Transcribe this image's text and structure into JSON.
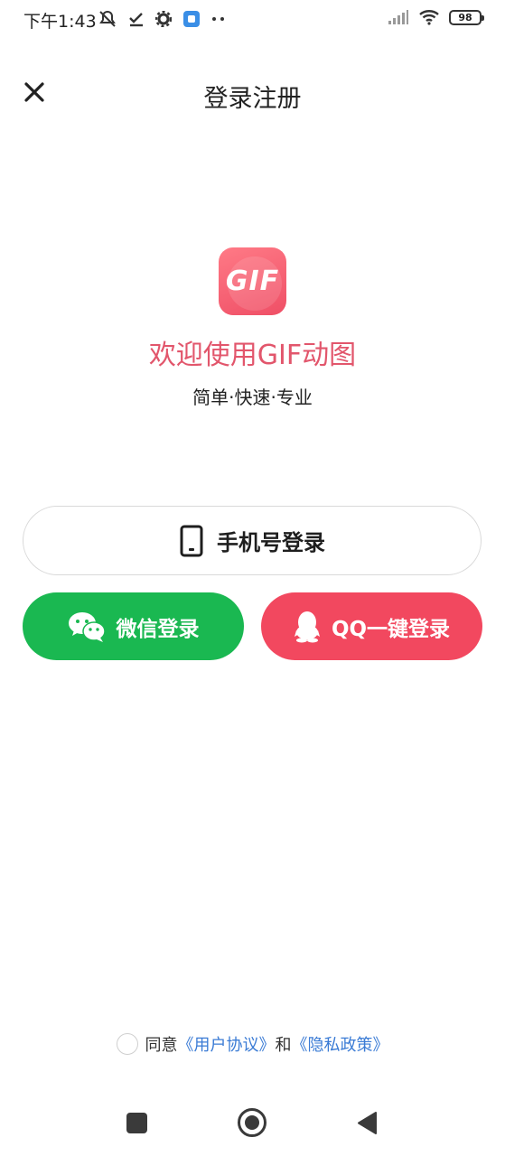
{
  "status_bar": {
    "time": "下午1:43",
    "battery": "98",
    "icons": [
      "mute-icon",
      "check-icon",
      "gear-icon",
      "app-notification-icon",
      "more-dots-icon",
      "signal-icon",
      "wifi-icon",
      "battery-icon"
    ]
  },
  "header": {
    "title": "登录注册",
    "close_icon": "close-icon"
  },
  "brand": {
    "logo_text": "GIF",
    "welcome": "欢迎使用GIF动图",
    "slogan": "简单·快速·专业"
  },
  "login": {
    "phone_label": "手机号登录",
    "wechat_label": "微信登录",
    "qq_label": "QQ一键登录"
  },
  "agreement": {
    "prefix": "同意",
    "user_agreement": "《用户协议》",
    "and": "和",
    "privacy_policy": "《隐私政策》"
  },
  "colors": {
    "brand_red": "#e2566c",
    "wechat_green": "#1ab851",
    "qq_red": "#f2485f",
    "link_blue": "#3a7bd5"
  }
}
